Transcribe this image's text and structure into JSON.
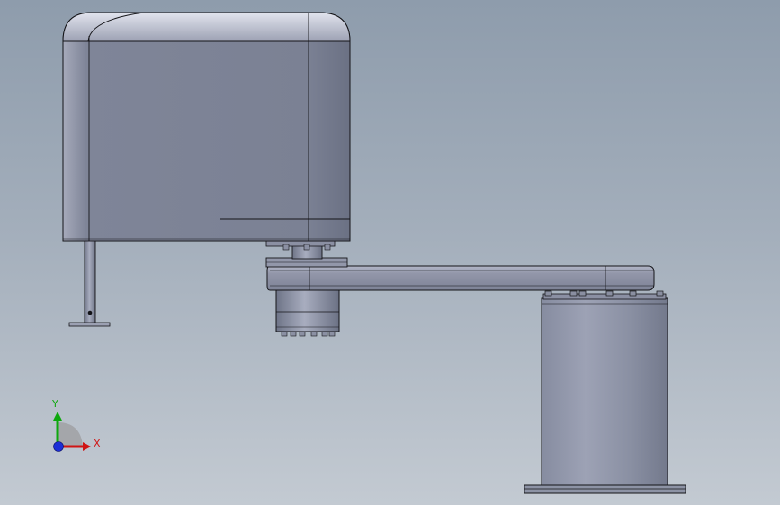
{
  "viewport": {
    "colors": {
      "background_top": "#8e9cac",
      "background_bottom": "#c3cad2",
      "part_face": "#7d8396",
      "part_highlight": "#b9bdcc",
      "edge": "#141418"
    }
  },
  "triad": {
    "x_label": "X",
    "y_label": "Y",
    "colors": {
      "x": "#d01414",
      "y": "#0ea80e",
      "z": "#1c2fd6"
    }
  }
}
